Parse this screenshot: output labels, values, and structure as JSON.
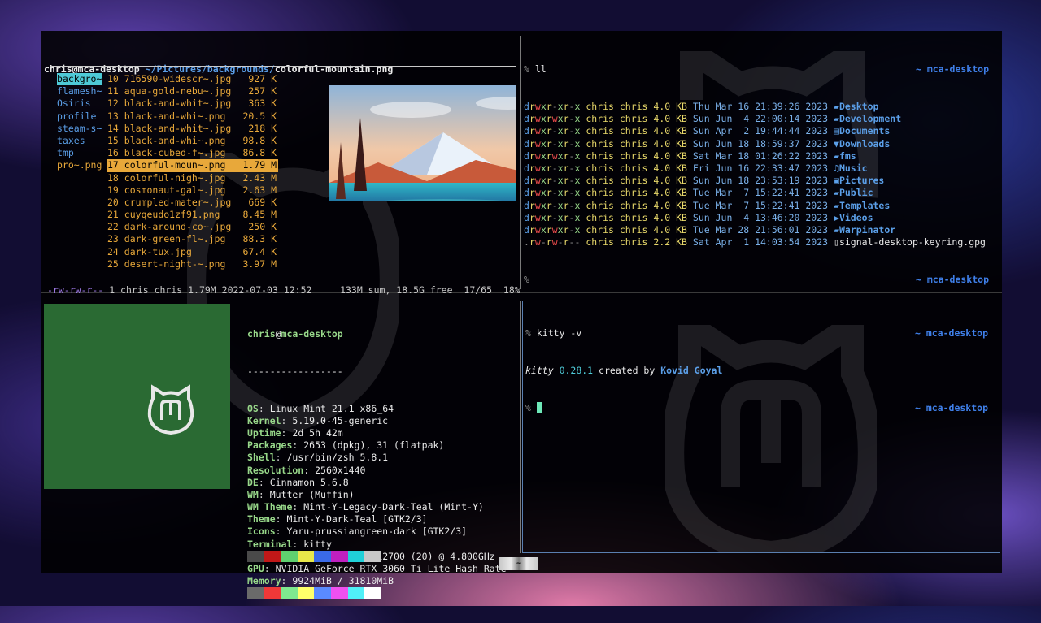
{
  "ranger": {
    "user_host": "chris@mca-desktop",
    "path_dir": "~/Pictures/backgrounds/",
    "path_file": "colorful-mountain.png",
    "parent_items": [
      "backgro~",
      "flamesh~",
      "Osiris",
      "profile",
      "steam-s~",
      "taxes",
      "tmp",
      "pro~.png"
    ],
    "files": [
      {
        "num": "10",
        "name": "716590-widescr~.jpg",
        "size": "927 K"
      },
      {
        "num": "11",
        "name": "aqua-gold-nebu~.jpg",
        "size": "257 K"
      },
      {
        "num": "12",
        "name": "black-and-whit~.jpg",
        "size": "363 K"
      },
      {
        "num": "13",
        "name": "black-and-whi~.png",
        "size": "20.5 K"
      },
      {
        "num": "14",
        "name": "black-and-whit~.jpg",
        "size": "218 K"
      },
      {
        "num": "15",
        "name": "black-and-whi~.png",
        "size": "98.8 K"
      },
      {
        "num": "16",
        "name": "black-cubed-f~.jpg",
        "size": "86.8 K"
      },
      {
        "num": "17",
        "name": "colorful-moun~.png",
        "size": "1.79 M"
      },
      {
        "num": "18",
        "name": "colorful-nigh~.jpg",
        "size": "2.43 M"
      },
      {
        "num": "19",
        "name": "cosmonaut-gal~.jpg",
        "size": "2.63 M"
      },
      {
        "num": "20",
        "name": "crumpled-mater~.jpg",
        "size": "669 K"
      },
      {
        "num": "21",
        "name": "cuyqeudo1zf91.png",
        "size": "8.45 M"
      },
      {
        "num": "22",
        "name": "dark-around-co~.jpg",
        "size": "250 K"
      },
      {
        "num": "23",
        "name": "dark-green-fl~.jpg",
        "size": "88.3 K"
      },
      {
        "num": "24",
        "name": "dark-tux.jpg",
        "size": "67.4 K"
      },
      {
        "num": "25",
        "name": "desert-night-~.png",
        "size": "3.97 M"
      }
    ],
    "status": {
      "perms": "-rw-rw-r--",
      "info": "1 chris chris 1.79M 2022-07-03 12:52",
      "summary": "133M sum, 18.5G free",
      "position": "17/65",
      "percent": "18%"
    }
  },
  "ll": {
    "prompt": "%",
    "command": "ll",
    "host": "~ mca-desktop",
    "rows": [
      {
        "perm": [
          "d",
          "r",
          "w",
          "x",
          "r",
          "-",
          "x",
          "r",
          "-",
          "x"
        ],
        "owner": "chris chris",
        "size": "4.0 KB",
        "date": "Thu Mar 16 21:39:26 2023",
        "icon": "folder-icon",
        "name": "Desktop"
      },
      {
        "perm": [
          "d",
          "r",
          "w",
          "x",
          "r",
          "w",
          "x",
          "r",
          "-",
          "x"
        ],
        "owner": "chris chris",
        "size": "4.0 KB",
        "date": "Sun Jun  4 22:00:14 2023",
        "icon": "folder-icon",
        "name": "Development"
      },
      {
        "perm": [
          "d",
          "r",
          "w",
          "x",
          "r",
          "-",
          "x",
          "r",
          "-",
          "x"
        ],
        "owner": "chris chris",
        "size": "4.0 KB",
        "date": "Sun Apr  2 19:44:44 2023",
        "icon": "documents-icon",
        "name": "Documents"
      },
      {
        "perm": [
          "d",
          "r",
          "w",
          "x",
          "r",
          "-",
          "x",
          "r",
          "-",
          "x"
        ],
        "owner": "chris chris",
        "size": "4.0 KB",
        "date": "Sun Jun 18 18:59:37 2023",
        "icon": "download-icon",
        "name": "Downloads"
      },
      {
        "perm": [
          "d",
          "r",
          "w",
          "x",
          "r",
          "w",
          "x",
          "r",
          "-",
          "x"
        ],
        "owner": "chris chris",
        "size": "4.0 KB",
        "date": "Sat Mar 18 01:26:22 2023",
        "icon": "folder-icon",
        "name": "fms"
      },
      {
        "perm": [
          "d",
          "r",
          "w",
          "x",
          "r",
          "-",
          "x",
          "r",
          "-",
          "x"
        ],
        "owner": "chris chris",
        "size": "4.0 KB",
        "date": "Fri Jun 16 22:33:47 2023",
        "icon": "music-icon",
        "name": "Music"
      },
      {
        "perm": [
          "d",
          "r",
          "w",
          "x",
          "r",
          "-",
          "x",
          "r",
          "-",
          "x"
        ],
        "owner": "chris chris",
        "size": "4.0 KB",
        "date": "Sun Jun 18 23:53:19 2023",
        "icon": "pictures-icon",
        "name": "Pictures"
      },
      {
        "perm": [
          "d",
          "r",
          "w",
          "x",
          "r",
          "-",
          "x",
          "r",
          "-",
          "x"
        ],
        "owner": "chris chris",
        "size": "4.0 KB",
        "date": "Tue Mar  7 15:22:41 2023",
        "icon": "folder-icon",
        "name": "Public"
      },
      {
        "perm": [
          "d",
          "r",
          "w",
          "x",
          "r",
          "-",
          "x",
          "r",
          "-",
          "x"
        ],
        "owner": "chris chris",
        "size": "4.0 KB",
        "date": "Tue Mar  7 15:22:41 2023",
        "icon": "folder-icon",
        "name": "Templates"
      },
      {
        "perm": [
          "d",
          "r",
          "w",
          "x",
          "r",
          "-",
          "x",
          "r",
          "-",
          "x"
        ],
        "owner": "chris chris",
        "size": "4.0 KB",
        "date": "Sun Jun  4 13:46:20 2023",
        "icon": "video-icon",
        "name": "Videos"
      },
      {
        "perm": [
          "d",
          "r",
          "w",
          "x",
          "r",
          "w",
          "x",
          "r",
          "-",
          "x"
        ],
        "owner": "chris chris",
        "size": "4.0 KB",
        "date": "Tue Mar 28 21:56:01 2023",
        "icon": "folder-icon",
        "name": "Warpinator"
      },
      {
        "perm": [
          ".",
          "r",
          "w",
          "-",
          "r",
          "w",
          "-",
          "r",
          "-",
          "-"
        ],
        "owner": "chris chris",
        "size": "2.2 KB",
        "date": "Sat Apr  1 14:03:54 2023",
        "icon": "file-icon",
        "name": "signal-desktop-keyring.gpg"
      }
    ]
  },
  "neofetch": {
    "user": "chris",
    "at": "@",
    "host": "mca-desktop",
    "separator": "-----------------",
    "fields": [
      {
        "key": "OS",
        "value": "Linux Mint 21.1 x86_64"
      },
      {
        "key": "Kernel",
        "value": "5.19.0-45-generic"
      },
      {
        "key": "Uptime",
        "value": "2d 5h 42m"
      },
      {
        "key": "Packages",
        "value": "2653 (dpkg), 31 (flatpak)"
      },
      {
        "key": "Shell",
        "value": "/usr/bin/zsh 5.8.1"
      },
      {
        "key": "Resolution",
        "value": "2560x1440"
      },
      {
        "key": "DE",
        "value": "Cinnamon 5.6.8"
      },
      {
        "key": "WM",
        "value": "Mutter (Muffin)"
      },
      {
        "key": "WM Theme",
        "value": "Mint-Y-Legacy-Dark-Teal (Mint-Y)"
      },
      {
        "key": "Theme",
        "value": "Mint-Y-Dark-Teal [GTK2/3]"
      },
      {
        "key": "Icons",
        "value": "Yaru-prussiangreen-dark [GTK2/3]"
      },
      {
        "key": "Terminal",
        "value": "kitty"
      },
      {
        "key": "CPU",
        "value": "12th Gen Intel i7-12700 (20) @ 4.800GHz"
      },
      {
        "key": "GPU",
        "value": "NVIDIA GeForce RTX 3060 Ti Lite Hash Rate"
      },
      {
        "key": "Memory",
        "value": "9924MiB / 31810MiB"
      }
    ],
    "palette_top": [
      "#4a4a4a",
      "#c01818",
      "#5fd06f",
      "#e8e84a",
      "#3a6ae8",
      "#c020c0",
      "#20d0d8",
      "#c8c8c8"
    ],
    "palette_bottom": [
      "#6a6a6a",
      "#f03838",
      "#7fe88f",
      "#ffff6a",
      "#5a8aff",
      "#f050f0",
      "#50f0f8",
      "#ffffff"
    ]
  },
  "kitty": {
    "prompt": "%",
    "command": "kitty -v",
    "host": "~ mca-desktop",
    "out_name": "kitty",
    "out_version": "0.28.1",
    "out_by": "created by",
    "out_author": "Kovid Goyal"
  },
  "tab": {
    "label": "~"
  }
}
